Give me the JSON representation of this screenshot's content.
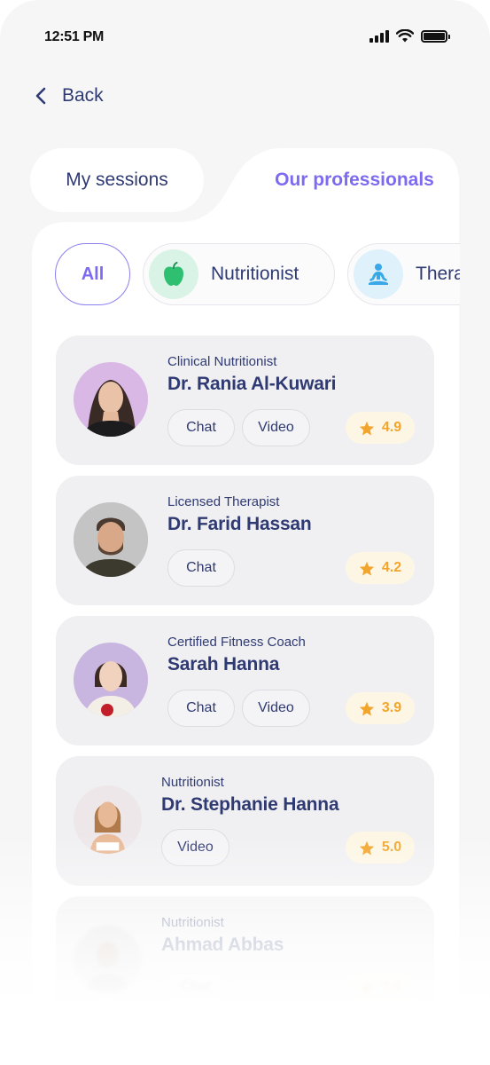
{
  "status_bar": {
    "time": "12:51 PM"
  },
  "nav": {
    "back_label": "Back"
  },
  "tabs": [
    {
      "label": "My sessions",
      "active": false
    },
    {
      "label": "Our professionals",
      "active": true
    }
  ],
  "filters": [
    {
      "label": "All",
      "active": true
    },
    {
      "label": "Nutritionist",
      "icon": "apple-icon",
      "icon_bg": "#d9f3e6",
      "icon_color": "#2fbf71"
    },
    {
      "label": "Therapist",
      "icon": "meditation-icon",
      "icon_bg": "#dff1fb",
      "icon_color": "#3aa8e6"
    }
  ],
  "professionals": [
    {
      "role": "Clinical Nutritionist",
      "name": "Dr. Rania Al-Kuwari",
      "actions": [
        "Chat",
        "Video"
      ],
      "rating": "4.9",
      "avatar_bg": "#d9b8e6"
    },
    {
      "role": "Licensed Therapist",
      "name": "Dr. Farid Hassan",
      "actions": [
        "Chat"
      ],
      "rating": "4.2",
      "avatar_bg": "#bdbdbd"
    },
    {
      "role": "Certified Fitness Coach",
      "name": "Sarah Hanna",
      "actions": [
        "Chat",
        "Video"
      ],
      "rating": "3.9",
      "avatar_bg": "#c9b6e0"
    },
    {
      "role": "Nutritionist",
      "name": "Dr. Stephanie Hanna",
      "actions": [
        "Video"
      ],
      "rating": "5.0",
      "avatar_bg": "#eee7ea"
    },
    {
      "role": "Nutritionist",
      "name": "Ahmad Abbas",
      "actions": [
        "Chat"
      ],
      "rating": "3.6",
      "avatar_bg": "#cfcfcf"
    }
  ],
  "colors": {
    "accent": "#7c6bf0",
    "text": "#2f3a72",
    "star": "#f2a52c",
    "rating_bg": "#fdf6e4"
  }
}
